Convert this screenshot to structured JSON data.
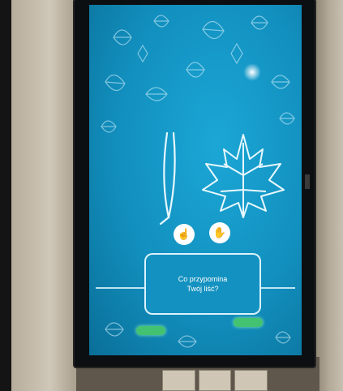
{
  "kiosk": {
    "question_line1": "Co przypomina",
    "question_line2": "Twój liść?",
    "left_button_label": "",
    "right_button_label": ""
  },
  "colors": {
    "screen_blue": "#128fbe",
    "accent_green": "#43c272",
    "line_white": "#e6f8ff"
  },
  "icons": {
    "option_a": "tap-hand-icon",
    "option_b": "leaf-hand-icon",
    "decorative": "maple-leaf-icon"
  }
}
